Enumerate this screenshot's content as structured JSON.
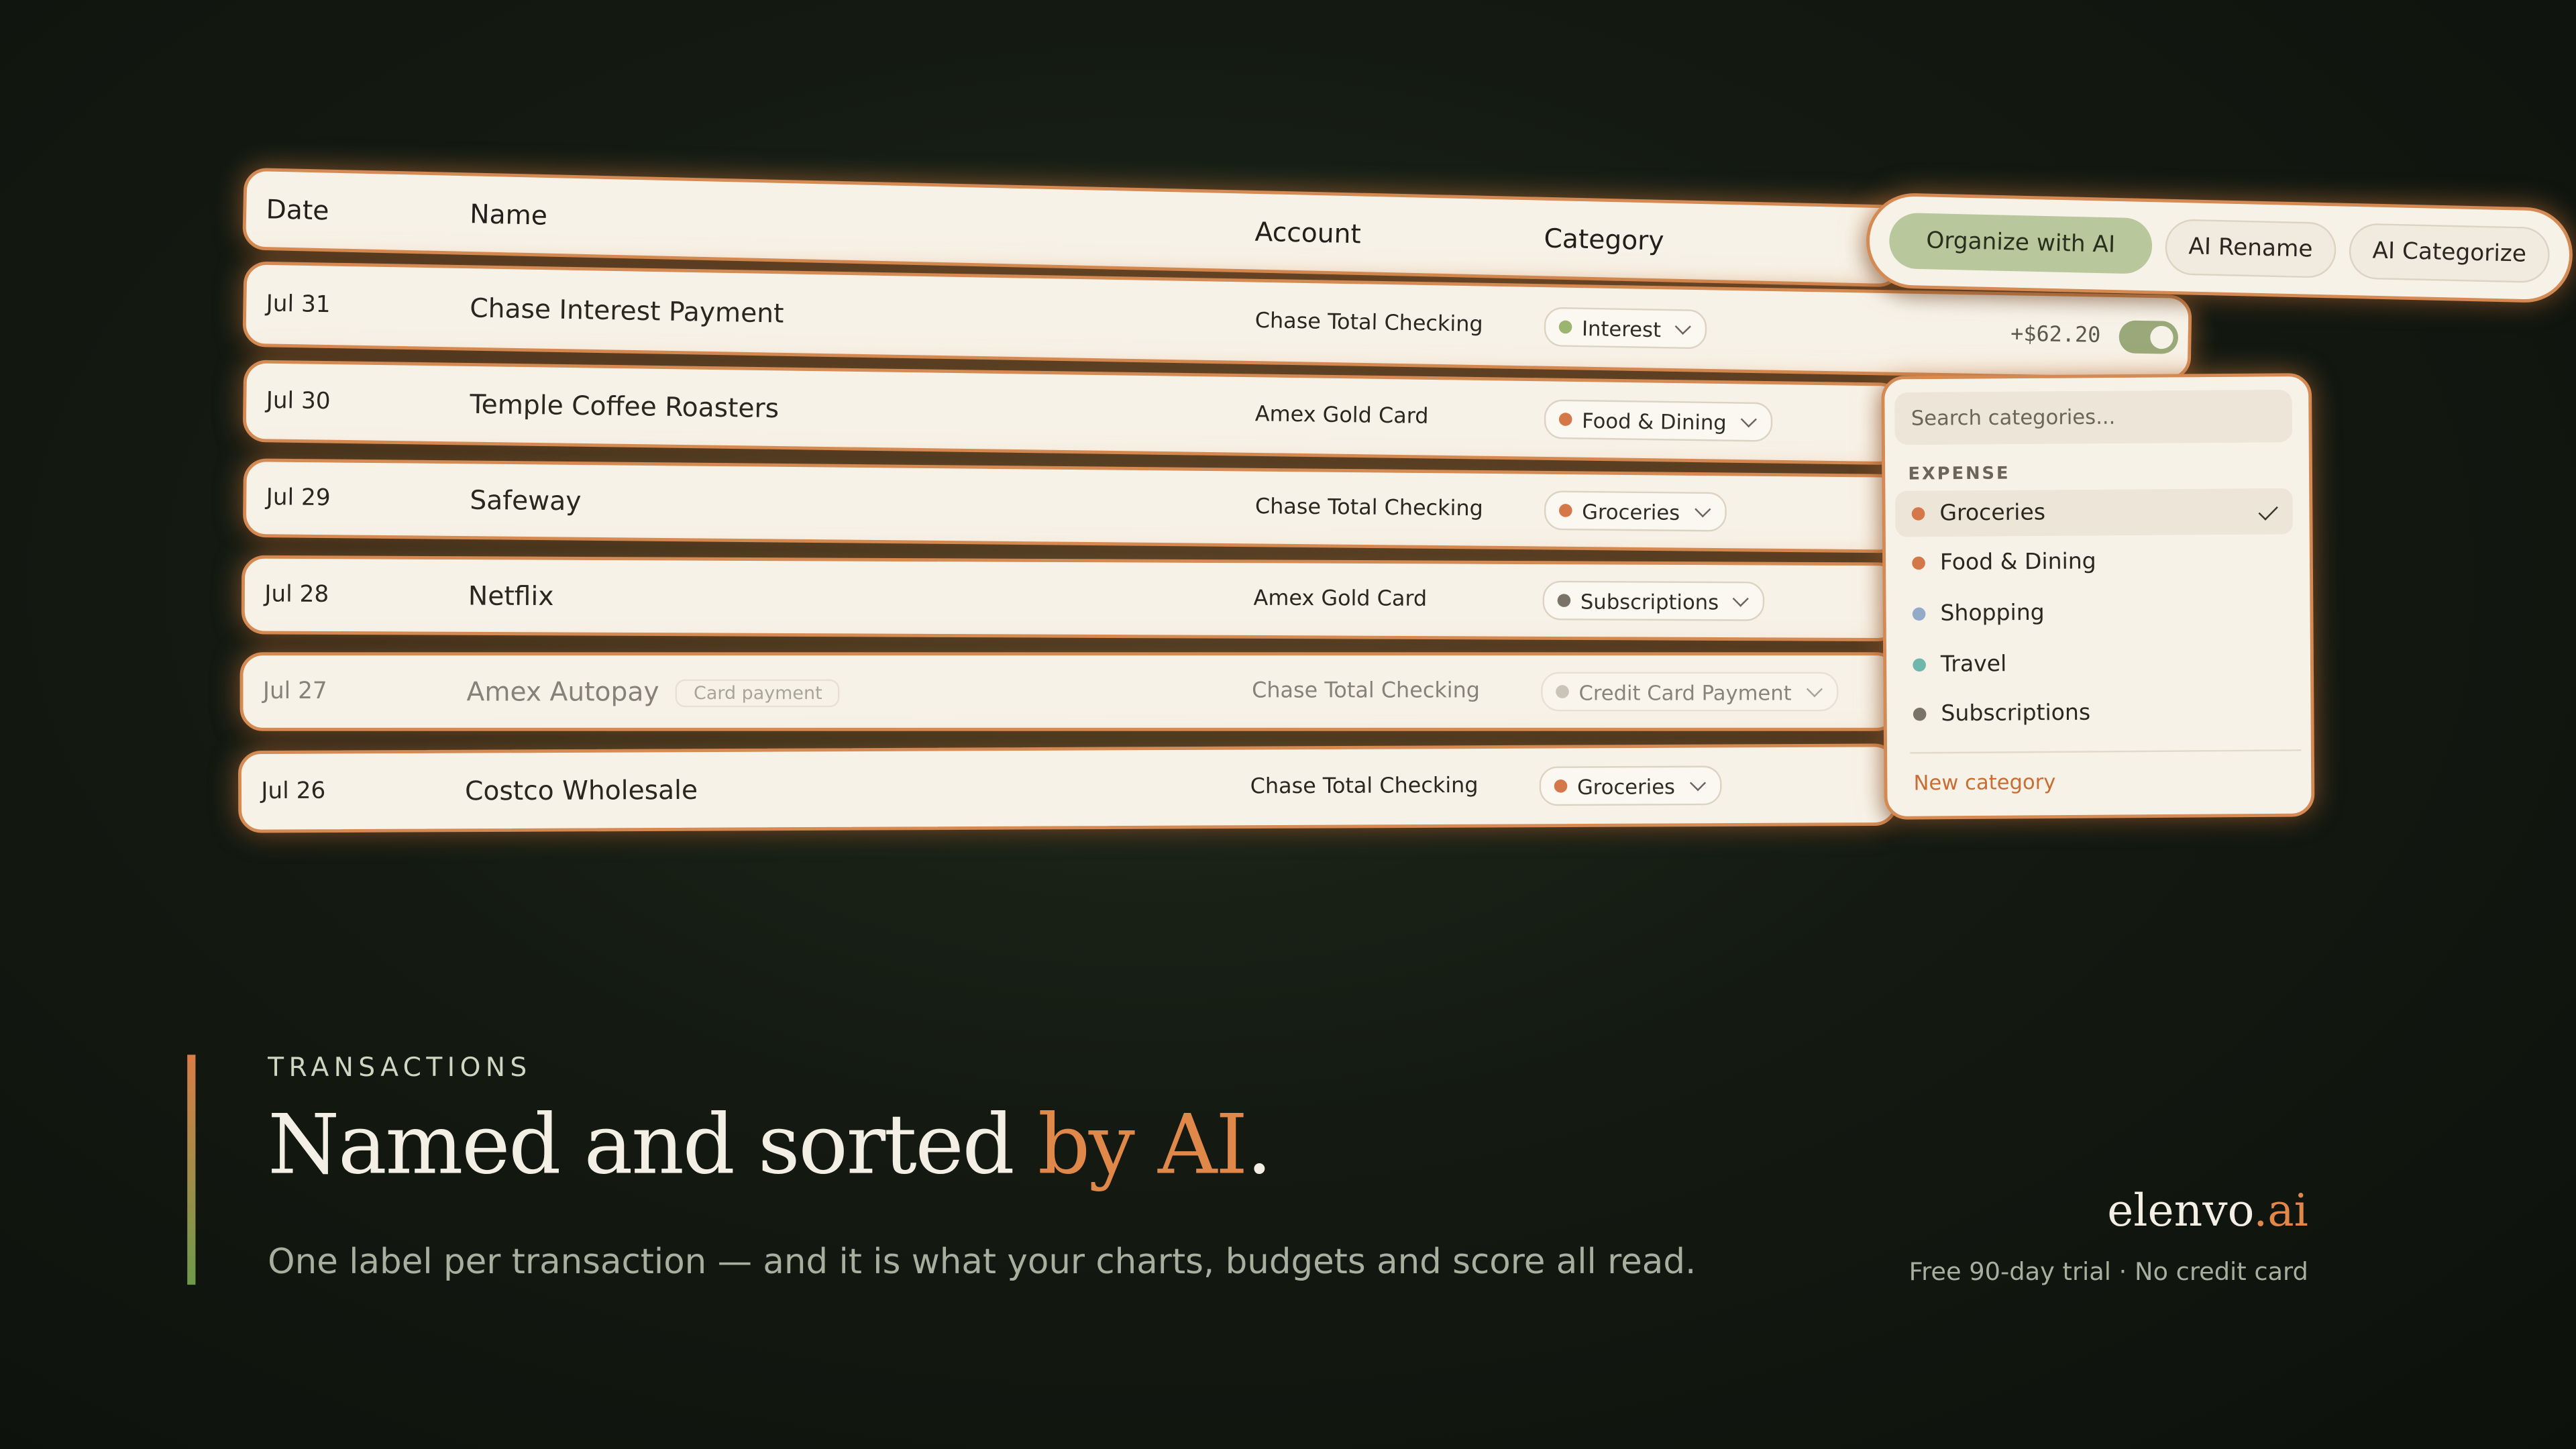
{
  "table": {
    "columns": {
      "date": "Date",
      "name": "Name",
      "account": "Account",
      "category": "Category"
    },
    "rows": [
      {
        "date": "Jul 31",
        "name": "Chase Interest Payment",
        "account": "Chase Total Checking",
        "category": "Interest",
        "category_color": "#9bb56f",
        "amount": "+$62.20"
      },
      {
        "date": "Jul 30",
        "name": "Temple Coffee Roasters",
        "account": "Amex Gold Card",
        "category": "Food & Dining",
        "category_color": "#d4784a"
      },
      {
        "date": "Jul 29",
        "name": "Safeway",
        "account": "Chase Total Checking",
        "category": "Groceries",
        "category_color": "#d4784a"
      },
      {
        "date": "Jul 28",
        "name": "Netflix",
        "account": "Amex Gold Card",
        "category": "Subscriptions",
        "category_color": "#7a7468"
      },
      {
        "date": "Jul 27",
        "name": "Amex Autopay",
        "tag": "Card payment",
        "account": "Chase Total Checking",
        "category": "Credit Card Payment",
        "category_color": "#a49e92"
      },
      {
        "date": "Jul 26",
        "name": "Costco Wholesale",
        "account": "Chase Total Checking",
        "category": "Groceries",
        "category_color": "#d4784a"
      }
    ]
  },
  "ai_toolbar": {
    "organize": "Organize with AI",
    "rename": "AI Rename",
    "categorize": "AI Categorize"
  },
  "category_menu": {
    "search_placeholder": "Search categories...",
    "section": "EXPENSE",
    "items": [
      {
        "label": "Groceries",
        "color": "#d4784a",
        "selected": true
      },
      {
        "label": "Food & Dining",
        "color": "#d4784a"
      },
      {
        "label": "Shopping",
        "color": "#93aac9"
      },
      {
        "label": "Travel",
        "color": "#6fb7aa"
      },
      {
        "label": "Subscriptions",
        "color": "#7a7468"
      }
    ],
    "new_category": "New category"
  },
  "hero": {
    "eyebrow": "TRANSACTIONS",
    "headline_plain": "Named and sorted ",
    "headline_accent": "by AI",
    "headline_end": ".",
    "subtitle": "One label per transaction — and it is what your charts, budgets and score all read."
  },
  "brand": {
    "name": "elenvo",
    "suffix": ".ai",
    "tagline": "Free 90-day trial · No credit card"
  }
}
